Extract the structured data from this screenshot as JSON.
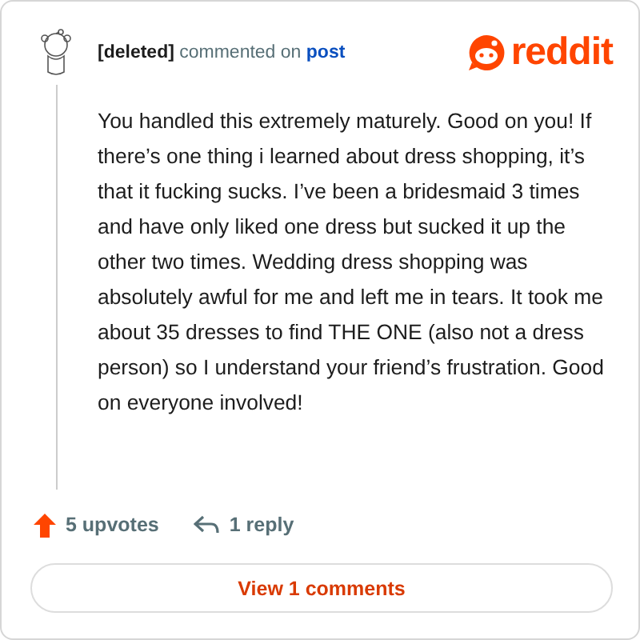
{
  "comment": {
    "author": "[deleted]",
    "action": "commented on",
    "target": "post",
    "body": "You handled this extremely maturely. Good on you! If there’s one thing i learned about dress shopping, it’s that it fucking sucks. I’ve been a bridesmaid 3 times and have only liked one dress but sucked it up the other two times. Wedding dress shopping was absolutely awful for me and left me in tears. It took me about 35 dresses to find THE ONE (also not a dress person) so I understand your friend’s frustration. Good on everyone involved!"
  },
  "logo": {
    "text": "reddit"
  },
  "footer": {
    "upvotes": "5 upvotes",
    "replies": "1 reply"
  },
  "view_button": "View 1 comments"
}
